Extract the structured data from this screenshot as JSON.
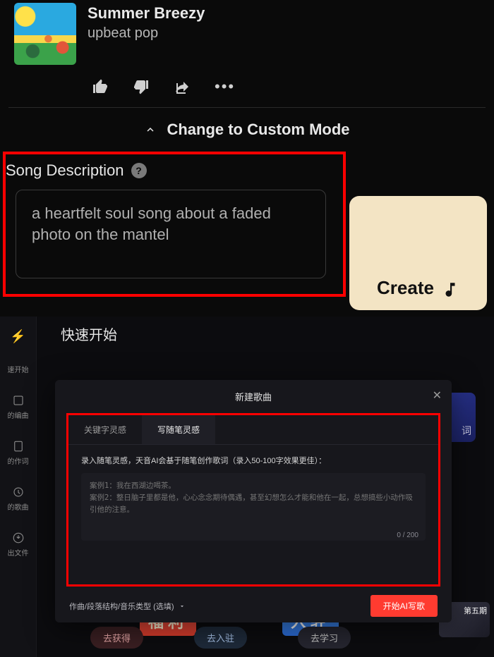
{
  "song": {
    "title": "Summer Breezy",
    "subtitle": "upbeat pop"
  },
  "mode_toggle": "Change to Custom Mode",
  "section": {
    "title": "Song Description",
    "help": "?",
    "placeholder": "a heartfelt soul song about a faded photo on the mantel"
  },
  "create_label": "Create",
  "bottom": {
    "quick_start": "快速开始",
    "rail": {
      "item0": "速开始",
      "item1": "的编曲",
      "item2": "的作词",
      "item3": "的歌曲",
      "item4": "出文件"
    },
    "bg_card": "词",
    "pills": {
      "p1": "去获得",
      "p2": "去入驻",
      "p3": "去学习"
    },
    "banners": {
      "fuli": "福利",
      "ruzhu": "入驻",
      "right": "第五期"
    }
  },
  "modal": {
    "title": "新建歌曲",
    "tabs": {
      "t1": "关键字灵感",
      "t2": "写随笔灵感"
    },
    "desc": "录入随笔灵感，天音AI会基于随笔创作歌词（录入50-100字效果更佳）：",
    "placeholder": "案例1：我在西湖边喝茶。\n案例2：整日脑子里都是他，心心念念期待偶遇，甚至幻想怎么才能和他在一起，总想搞些小动作吸引他的注意。",
    "char_count": "0 / 200",
    "foot_left": "作曲/段落结构/音乐类型 (选填)",
    "foot_btn": "开始AI写歌"
  }
}
